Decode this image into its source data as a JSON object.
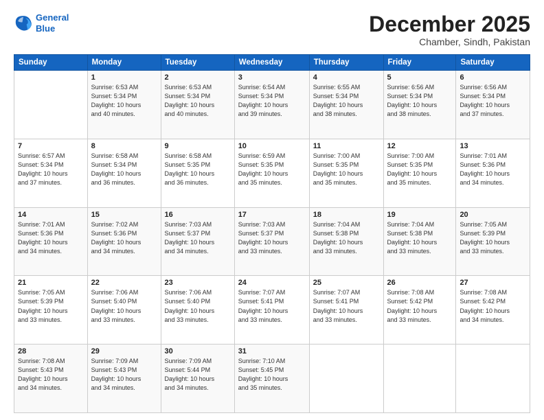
{
  "header": {
    "logo_line1": "General",
    "logo_line2": "Blue",
    "month": "December 2025",
    "location": "Chamber, Sindh, Pakistan"
  },
  "weekdays": [
    "Sunday",
    "Monday",
    "Tuesday",
    "Wednesday",
    "Thursday",
    "Friday",
    "Saturday"
  ],
  "weeks": [
    [
      {
        "day": "",
        "info": ""
      },
      {
        "day": "1",
        "info": "Sunrise: 6:53 AM\nSunset: 5:34 PM\nDaylight: 10 hours\nand 40 minutes."
      },
      {
        "day": "2",
        "info": "Sunrise: 6:53 AM\nSunset: 5:34 PM\nDaylight: 10 hours\nand 40 minutes."
      },
      {
        "day": "3",
        "info": "Sunrise: 6:54 AM\nSunset: 5:34 PM\nDaylight: 10 hours\nand 39 minutes."
      },
      {
        "day": "4",
        "info": "Sunrise: 6:55 AM\nSunset: 5:34 PM\nDaylight: 10 hours\nand 38 minutes."
      },
      {
        "day": "5",
        "info": "Sunrise: 6:56 AM\nSunset: 5:34 PM\nDaylight: 10 hours\nand 38 minutes."
      },
      {
        "day": "6",
        "info": "Sunrise: 6:56 AM\nSunset: 5:34 PM\nDaylight: 10 hours\nand 37 minutes."
      }
    ],
    [
      {
        "day": "7",
        "info": "Sunrise: 6:57 AM\nSunset: 5:34 PM\nDaylight: 10 hours\nand 37 minutes."
      },
      {
        "day": "8",
        "info": "Sunrise: 6:58 AM\nSunset: 5:34 PM\nDaylight: 10 hours\nand 36 minutes."
      },
      {
        "day": "9",
        "info": "Sunrise: 6:58 AM\nSunset: 5:35 PM\nDaylight: 10 hours\nand 36 minutes."
      },
      {
        "day": "10",
        "info": "Sunrise: 6:59 AM\nSunset: 5:35 PM\nDaylight: 10 hours\nand 35 minutes."
      },
      {
        "day": "11",
        "info": "Sunrise: 7:00 AM\nSunset: 5:35 PM\nDaylight: 10 hours\nand 35 minutes."
      },
      {
        "day": "12",
        "info": "Sunrise: 7:00 AM\nSunset: 5:35 PM\nDaylight: 10 hours\nand 35 minutes."
      },
      {
        "day": "13",
        "info": "Sunrise: 7:01 AM\nSunset: 5:36 PM\nDaylight: 10 hours\nand 34 minutes."
      }
    ],
    [
      {
        "day": "14",
        "info": "Sunrise: 7:01 AM\nSunset: 5:36 PM\nDaylight: 10 hours\nand 34 minutes."
      },
      {
        "day": "15",
        "info": "Sunrise: 7:02 AM\nSunset: 5:36 PM\nDaylight: 10 hours\nand 34 minutes."
      },
      {
        "day": "16",
        "info": "Sunrise: 7:03 AM\nSunset: 5:37 PM\nDaylight: 10 hours\nand 34 minutes."
      },
      {
        "day": "17",
        "info": "Sunrise: 7:03 AM\nSunset: 5:37 PM\nDaylight: 10 hours\nand 33 minutes."
      },
      {
        "day": "18",
        "info": "Sunrise: 7:04 AM\nSunset: 5:38 PM\nDaylight: 10 hours\nand 33 minutes."
      },
      {
        "day": "19",
        "info": "Sunrise: 7:04 AM\nSunset: 5:38 PM\nDaylight: 10 hours\nand 33 minutes."
      },
      {
        "day": "20",
        "info": "Sunrise: 7:05 AM\nSunset: 5:39 PM\nDaylight: 10 hours\nand 33 minutes."
      }
    ],
    [
      {
        "day": "21",
        "info": "Sunrise: 7:05 AM\nSunset: 5:39 PM\nDaylight: 10 hours\nand 33 minutes."
      },
      {
        "day": "22",
        "info": "Sunrise: 7:06 AM\nSunset: 5:40 PM\nDaylight: 10 hours\nand 33 minutes."
      },
      {
        "day": "23",
        "info": "Sunrise: 7:06 AM\nSunset: 5:40 PM\nDaylight: 10 hours\nand 33 minutes."
      },
      {
        "day": "24",
        "info": "Sunrise: 7:07 AM\nSunset: 5:41 PM\nDaylight: 10 hours\nand 33 minutes."
      },
      {
        "day": "25",
        "info": "Sunrise: 7:07 AM\nSunset: 5:41 PM\nDaylight: 10 hours\nand 33 minutes."
      },
      {
        "day": "26",
        "info": "Sunrise: 7:08 AM\nSunset: 5:42 PM\nDaylight: 10 hours\nand 33 minutes."
      },
      {
        "day": "27",
        "info": "Sunrise: 7:08 AM\nSunset: 5:42 PM\nDaylight: 10 hours\nand 34 minutes."
      }
    ],
    [
      {
        "day": "28",
        "info": "Sunrise: 7:08 AM\nSunset: 5:43 PM\nDaylight: 10 hours\nand 34 minutes."
      },
      {
        "day": "29",
        "info": "Sunrise: 7:09 AM\nSunset: 5:43 PM\nDaylight: 10 hours\nand 34 minutes."
      },
      {
        "day": "30",
        "info": "Sunrise: 7:09 AM\nSunset: 5:44 PM\nDaylight: 10 hours\nand 34 minutes."
      },
      {
        "day": "31",
        "info": "Sunrise: 7:10 AM\nSunset: 5:45 PM\nDaylight: 10 hours\nand 35 minutes."
      },
      {
        "day": "",
        "info": ""
      },
      {
        "day": "",
        "info": ""
      },
      {
        "day": "",
        "info": ""
      }
    ]
  ]
}
